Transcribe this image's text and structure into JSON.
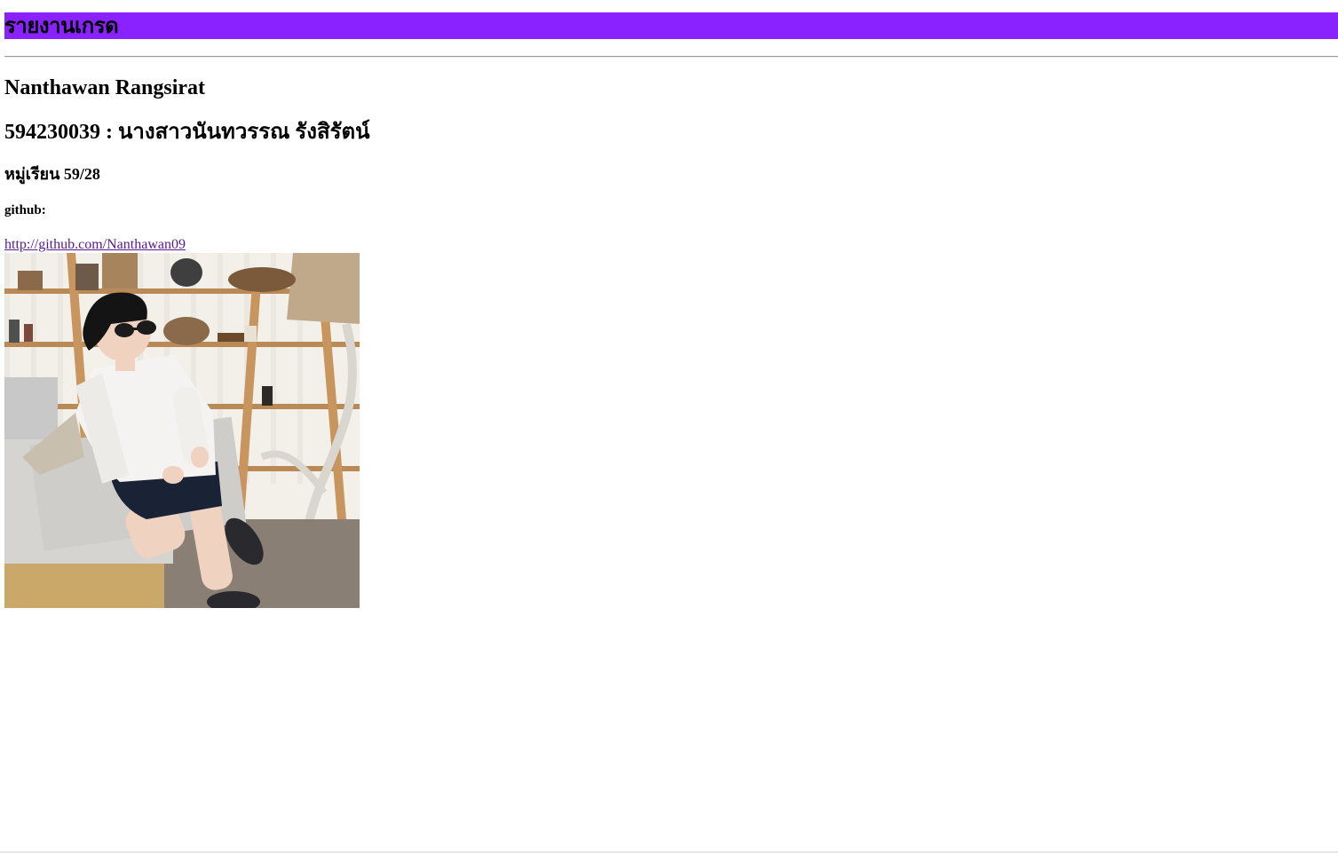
{
  "header": {
    "title": "รายงานเกรด",
    "background_color": "#8a22ff"
  },
  "student": {
    "name_en": "Nanthawan Rangsirat",
    "id_and_name_th": "594230039 : นางสาวนันทวรรณ รังสิรัตน์",
    "group": "หมู่เรียน 59/28"
  },
  "github": {
    "label": "github:",
    "url_text": "http://github.com/Nanthawan09",
    "link_color": "#551a8b"
  },
  "photo": {
    "icon": "portrait-photo"
  }
}
